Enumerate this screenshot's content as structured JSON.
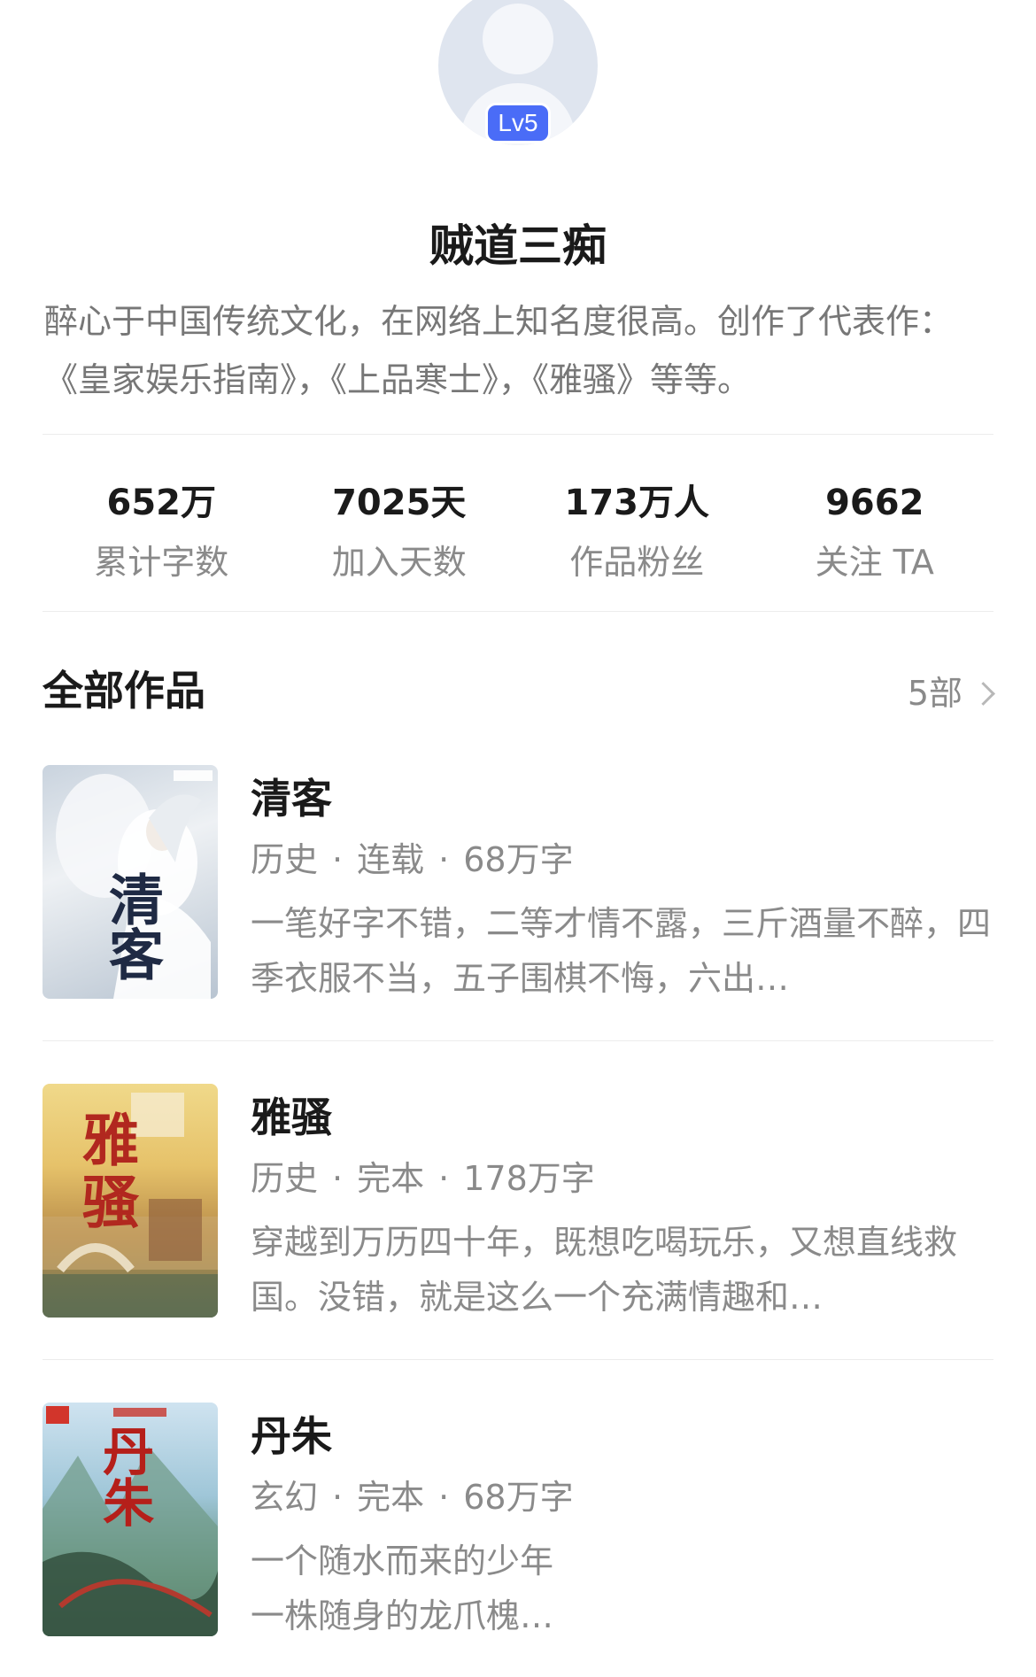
{
  "profile": {
    "level": "Lv5",
    "name": "贼道三痴",
    "bio": "醉心于中国传统文化，在网络上知名度很高。创作了代表作：《皇家娱乐指南》，《上品寒士》，《雅骚》等等。"
  },
  "stats": [
    {
      "value": "652万",
      "label": "累计字数"
    },
    {
      "value": "7025天",
      "label": "加入天数"
    },
    {
      "value": "173万人",
      "label": "作品粉丝"
    },
    {
      "value": "9662",
      "label": "关注 TA"
    }
  ],
  "works": {
    "title": "全部作品",
    "count": "5部",
    "items": [
      {
        "title": "清客",
        "genre": "历史",
        "status": "连载",
        "words": "68万字",
        "desc": "一笔好字不错，二等才情不露，三斤酒量不醉，四季衣服不当，五子围棋不悔，六出…",
        "cover_text": "清客"
      },
      {
        "title": "雅骚",
        "genre": "历史",
        "status": "完本",
        "words": "178万字",
        "desc": "穿越到万历四十年，既想吃喝玩乐，又想直线救国。没错，就是这么一个充满情趣和…",
        "cover_text": "雅骚"
      },
      {
        "title": "丹朱",
        "genre": "玄幻",
        "status": "完本",
        "words": "68万字",
        "desc": "一个随水而来的少年\n一株随身的龙爪槐…",
        "cover_text": "丹朱"
      }
    ]
  },
  "colors": {
    "accent": "#4a6cf7",
    "text_primary": "#1a1a1a",
    "text_secondary": "#8a8a8a",
    "divider": "#ececec"
  }
}
